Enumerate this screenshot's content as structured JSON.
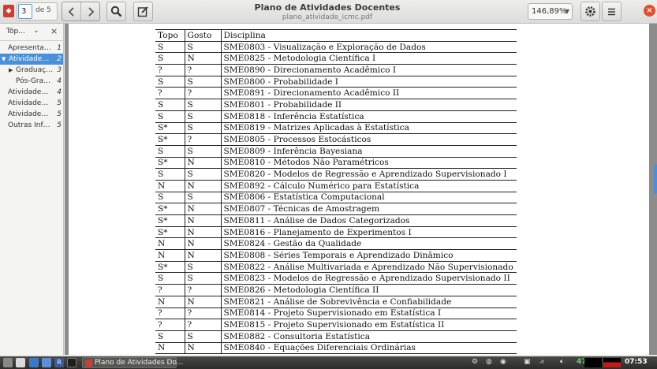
{
  "header": {
    "title": "Plano de Atividades Docentes",
    "subtitle": "plano_atividade_icmc.pdf",
    "page_current": "3",
    "page_total_label": "de 5",
    "zoom": "146,89%"
  },
  "sidebar": {
    "header_label": "Tóp...",
    "items": [
      {
        "label": "Apresentaç...",
        "page": "1"
      },
      {
        "label": "Atividades ...",
        "page": "2"
      },
      {
        "label": "Graduação",
        "page": "3"
      },
      {
        "label": "Pós-Grad...",
        "page": "4"
      },
      {
        "label": "Atividades ...",
        "page": "4"
      },
      {
        "label": "Atividades ...",
        "page": "5"
      },
      {
        "label": "Atividades ...",
        "page": "5"
      },
      {
        "label": "Outras Infor...",
        "page": "5"
      }
    ]
  },
  "table": {
    "headers": [
      "Topo",
      "Gosto",
      "Disciplina"
    ],
    "rows": [
      [
        "S",
        "S",
        "SME0803 - Visualização e Exploração de Dados"
      ],
      [
        "S",
        "N",
        "SME0825 - Metodologia Científica I"
      ],
      [
        "?",
        "?",
        "SME0890 - Direcionamento Acadêmico I"
      ],
      [
        "S",
        "S",
        "SME0800 - Probabilidade I"
      ],
      [
        "?",
        "?",
        "SME0891 - Direcionamento Acadêmico II"
      ],
      [
        "S",
        "S",
        "SME0801 - Probabilidade II"
      ],
      [
        "S",
        "S",
        "SME0818 - Inferência Estatística"
      ],
      [
        "S*",
        "S",
        "SME0819 - Matrizes Aplicadas à Estatística"
      ],
      [
        "S*",
        "?",
        "SME0805 - Processos Estocásticos"
      ],
      [
        "S",
        "S",
        "SME0809 - Inferência Bayesiana"
      ],
      [
        "S*",
        "N",
        "SME0810 - Métodos Não Paramétricos"
      ],
      [
        "S",
        "S",
        "SME0820 - Modelos de Regressão e Aprendizado Supervisionado I"
      ],
      [
        "N",
        "N",
        "SME0892 - Cálculo Numérico para Estatística"
      ],
      [
        "S",
        "S",
        "SME0806 - Estatística Computacional"
      ],
      [
        "S*",
        "N",
        "SME0807 - Técnicas de Amostragem"
      ],
      [
        "S*",
        "N",
        "SME0811 - Análise de Dados Categorizados"
      ],
      [
        "S*",
        "N",
        "SME0816 - Planejamento de Experimentos I"
      ],
      [
        "N",
        "N",
        "SME0824 - Gestão da Qualidade"
      ],
      [
        "N",
        "N",
        "SME0808 - Séries Temporais e Aprendizado Dinâmico"
      ],
      [
        "S*",
        "S",
        "SME0822 - Análise Multivariada e Aprendizado Não Supervisionado"
      ],
      [
        "S",
        "S",
        "SME0823 - Modelos de Regressão e Aprendizado Supervisionado II"
      ],
      [
        "?",
        "?",
        "SME0826 - Metodologia Científica II"
      ],
      [
        "N",
        "N",
        "SME0821 - Análise de Sobrevivência e Confiabilidade"
      ],
      [
        "?",
        "?",
        "SME0814 - Projeto Supervisionado em Estatística I"
      ],
      [
        "?",
        "?",
        "SME0815 - Projeto Supervisionado em Estatística II"
      ],
      [
        "S",
        "S",
        "SME0882 - Consultoria Estatística"
      ],
      [
        "N",
        "N",
        "SME0840 - Equações Diferenciais Ordinárias"
      ]
    ]
  },
  "taskbar": {
    "task_label": "Plano de Atividades Do...",
    "count": "47",
    "clock": "07:53"
  },
  "colors": {
    "selection": "#4a90d9",
    "doc_background": "#8c8c8c",
    "close_button": "#e0502f"
  }
}
